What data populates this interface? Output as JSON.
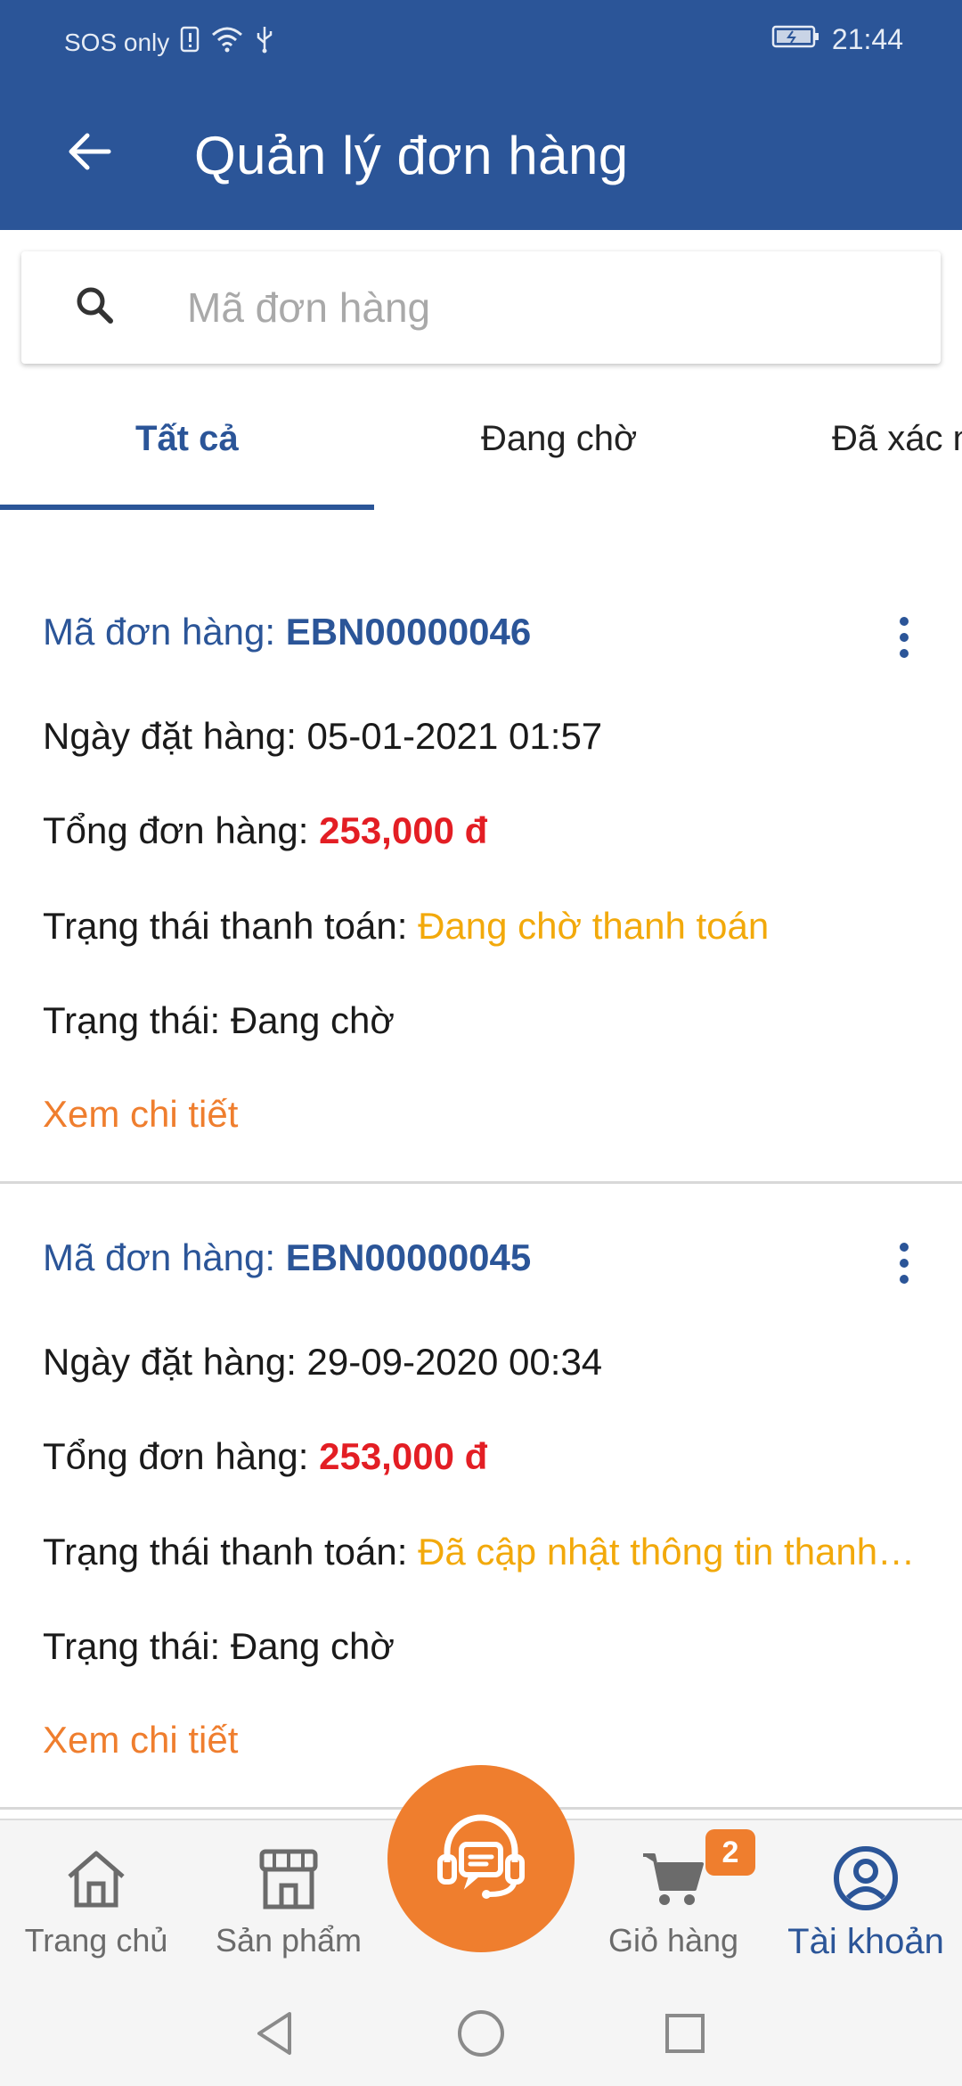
{
  "status_bar": {
    "carrier": "SOS only",
    "time": "21:44"
  },
  "header": {
    "title": "Quản lý đơn hàng"
  },
  "search": {
    "placeholder": "Mã đơn hàng"
  },
  "tabs": [
    {
      "label": "Tất cả",
      "active": true
    },
    {
      "label": "Đang chờ",
      "active": false
    },
    {
      "label": "Đã xác nhận",
      "active": false
    }
  ],
  "orders": [
    {
      "code_label": "Mã đơn hàng:",
      "code": "EBN00000046",
      "date_label": "Ngày đặt hàng:",
      "date": "05-01-2021 01:57",
      "total_label": "Tổng đơn hàng:",
      "total": "253,000 đ",
      "payment_label": "Trạng thái thanh toán:",
      "payment_status": "Đang chờ thanh toán",
      "status_label": "Trạng thái:",
      "status": "Đang chờ",
      "detail_link": "Xem chi tiết"
    },
    {
      "code_label": "Mã đơn hàng:",
      "code": "EBN00000045",
      "date_label": "Ngày đặt hàng:",
      "date": "29-09-2020 00:34",
      "total_label": "Tổng đơn hàng:",
      "total": "253,000 đ",
      "payment_label": "Trạng thái thanh toán:",
      "payment_status": "Đã cập nhật thông tin thanh toán",
      "status_label": "Trạng thái:",
      "status": "Đang chờ",
      "detail_link": "Xem chi tiết"
    }
  ],
  "bottom_nav": {
    "home": "Trang chủ",
    "products": "Sản phẩm",
    "cart": "Giỏ hàng",
    "cart_badge": "2",
    "account": "Tài khoản"
  },
  "colors": {
    "primary": "#2b5598",
    "accent": "#ef7e2e",
    "price": "#e31e24",
    "payment_status": "#f2a90b"
  }
}
